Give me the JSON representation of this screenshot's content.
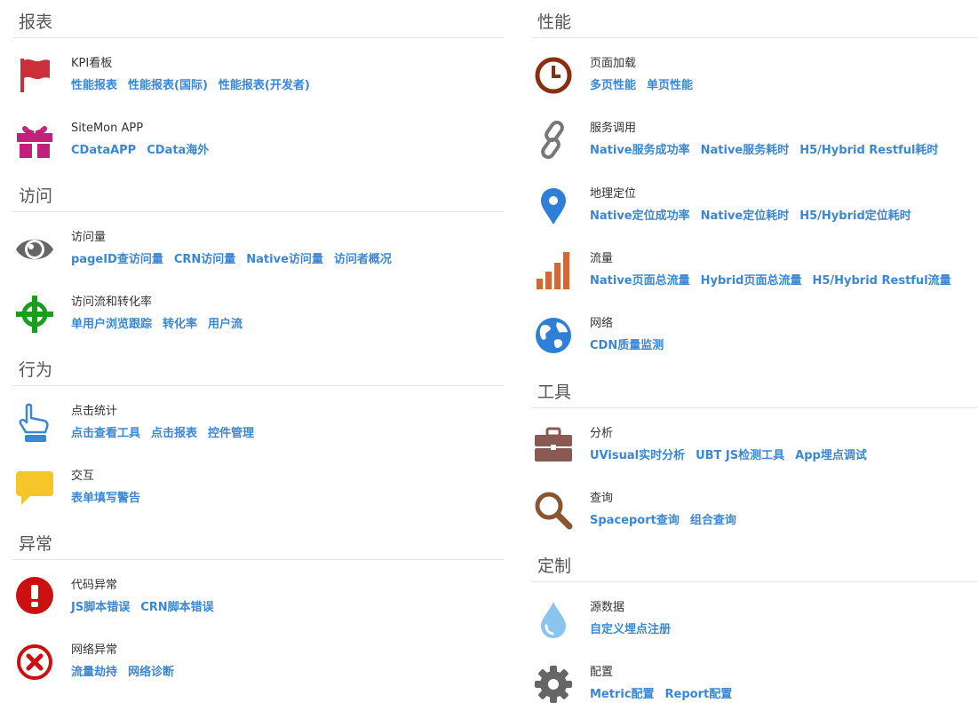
{
  "left": {
    "sections": [
      {
        "title": "报表",
        "items": [
          {
            "icon": "flag-icon",
            "title": "KPI看板",
            "links": [
              "性能报表",
              "性能报表(国际)",
              "性能报表(开发者)"
            ]
          },
          {
            "icon": "gift-icon",
            "title": "SiteMon APP",
            "links": [
              "CDataAPP",
              "CData海外"
            ]
          }
        ]
      },
      {
        "title": "访问",
        "items": [
          {
            "icon": "eye-icon",
            "title": "访问量",
            "links": [
              "pageID查访问量",
              "CRN访问量",
              "Native访问量",
              "访问者概况"
            ]
          },
          {
            "icon": "crosshair-icon",
            "title": "访问流和转化率",
            "links": [
              "单用户浏览跟踪",
              "转化率",
              "用户流"
            ]
          }
        ]
      },
      {
        "title": "行为",
        "items": [
          {
            "icon": "hand-pointer-icon",
            "title": "点击统计",
            "links": [
              "点击查看工具",
              "点击报表",
              "控件管理"
            ]
          },
          {
            "icon": "comment-icon",
            "title": "交互",
            "links": [
              "表单填写警告"
            ]
          }
        ]
      },
      {
        "title": "异常",
        "items": [
          {
            "icon": "exclamation-icon",
            "title": "代码异常",
            "links": [
              "JS脚本错误",
              "CRN脚本错误"
            ]
          },
          {
            "icon": "times-circle-icon",
            "title": "网络异常",
            "links": [
              "流量劫持",
              "网络诊断"
            ]
          }
        ]
      }
    ]
  },
  "right": {
    "sections": [
      {
        "title": "性能",
        "items": [
          {
            "icon": "clock-icon",
            "title": "页面加载",
            "links": [
              "多页性能",
              "单页性能"
            ]
          },
          {
            "icon": "link-icon",
            "title": "服务调用",
            "links": [
              "Native服务成功率",
              "Native服务耗时",
              "H5/Hybrid Restful耗时"
            ]
          },
          {
            "icon": "map-marker-icon",
            "title": "地理定位",
            "links": [
              "Native定位成功率",
              "Native定位耗时",
              "H5/Hybrid定位耗时"
            ]
          },
          {
            "icon": "bar-chart-icon",
            "title": "流量",
            "links": [
              "Native页面总流量",
              "Hybrid页面总流量",
              "H5/Hybrid Restful流量"
            ]
          },
          {
            "icon": "globe-icon",
            "title": "网络",
            "links": [
              "CDN质量监测"
            ]
          }
        ]
      },
      {
        "title": "工具",
        "items": [
          {
            "icon": "briefcase-icon",
            "title": "分析",
            "links": [
              "UVisual实时分析",
              "UBT JS检测工具",
              "App埋点调试"
            ]
          },
          {
            "icon": "search-icon",
            "title": "查询",
            "links": [
              "Spaceport查询",
              "组合查询"
            ]
          }
        ]
      },
      {
        "title": "定制",
        "items": [
          {
            "icon": "tint-icon",
            "title": "源数据",
            "links": [
              "自定义埋点注册"
            ]
          },
          {
            "icon": "gear-icon",
            "title": "配置",
            "links": [
              "Metric配置",
              "Report配置"
            ]
          }
        ]
      }
    ]
  },
  "colors": {
    "link": "#3a87d6",
    "flag": "#c9303a",
    "gift": "#c2217b",
    "eye": "#666666",
    "crosshair": "#17a01c",
    "hand": "#3a87d6",
    "comment": "#f5c52a",
    "exclamation": "#cc1010",
    "times": "#cc1010",
    "clock": "#8b2e10",
    "link_icon": "#777777",
    "marker": "#2f7fd8",
    "bars": "#d2683a",
    "globe": "#2f7fd8",
    "briefcase": "#8a5a52",
    "search": "#8a5530",
    "tint": "#8cc4f0",
    "gear": "#666666"
  }
}
